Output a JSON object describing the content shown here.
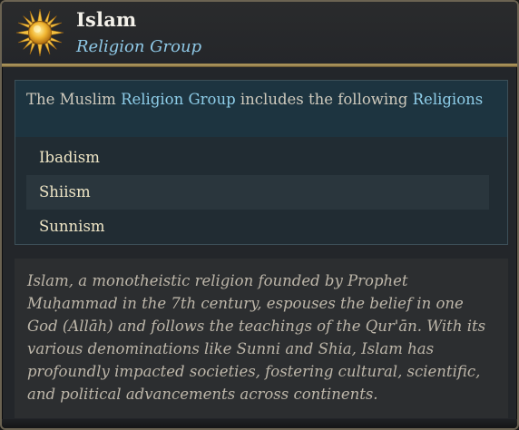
{
  "header": {
    "title": "Islam",
    "subtitle": "Religion Group",
    "icon": "sun-icon"
  },
  "list": {
    "intro_prefix": "The Muslim ",
    "intro_group": "Religion Group",
    "intro_middle": " includes the following ",
    "intro_religions": "Religions",
    "items": [
      {
        "label": "Ibadism"
      },
      {
        "label": "Shiism"
      },
      {
        "label": "Sunnism"
      }
    ]
  },
  "description": "Islam, a monotheistic religion founded by Prophet Muḥammad in the 7th century, espouses the belief in one God (Allāh) and follows the teachings of the Qur'ān. With its various denominations like Sunni and Shia, Islam has profoundly impacted societies, fostering cultural, scientific, and political advancements across continents.",
  "colors": {
    "accent_blue": "#8ecde8",
    "gold_divider": "#b9a062",
    "item_text": "#efe6c6"
  }
}
